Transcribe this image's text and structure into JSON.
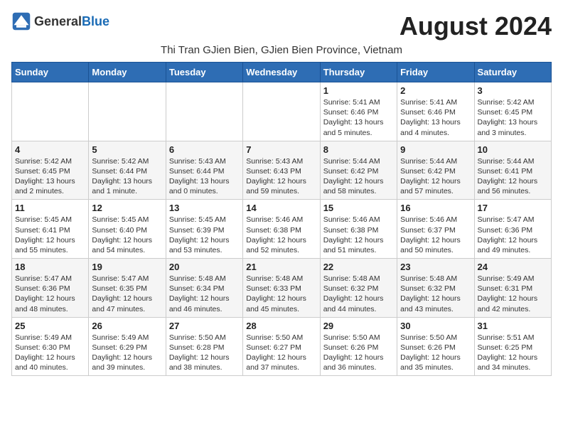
{
  "header": {
    "logo_general": "General",
    "logo_blue": "Blue",
    "title": "August 2024",
    "subtitle": "Thi Tran GJien Bien, GJien Bien Province, Vietnam"
  },
  "days_of_week": [
    "Sunday",
    "Monday",
    "Tuesday",
    "Wednesday",
    "Thursday",
    "Friday",
    "Saturday"
  ],
  "weeks": [
    [
      {
        "day": "",
        "info": ""
      },
      {
        "day": "",
        "info": ""
      },
      {
        "day": "",
        "info": ""
      },
      {
        "day": "",
        "info": ""
      },
      {
        "day": "1",
        "info": "Sunrise: 5:41 AM\nSunset: 6:46 PM\nDaylight: 13 hours\nand 5 minutes."
      },
      {
        "day": "2",
        "info": "Sunrise: 5:41 AM\nSunset: 6:46 PM\nDaylight: 13 hours\nand 4 minutes."
      },
      {
        "day": "3",
        "info": "Sunrise: 5:42 AM\nSunset: 6:45 PM\nDaylight: 13 hours\nand 3 minutes."
      }
    ],
    [
      {
        "day": "4",
        "info": "Sunrise: 5:42 AM\nSunset: 6:45 PM\nDaylight: 13 hours\nand 2 minutes."
      },
      {
        "day": "5",
        "info": "Sunrise: 5:42 AM\nSunset: 6:44 PM\nDaylight: 13 hours\nand 1 minute."
      },
      {
        "day": "6",
        "info": "Sunrise: 5:43 AM\nSunset: 6:44 PM\nDaylight: 13 hours\nand 0 minutes."
      },
      {
        "day": "7",
        "info": "Sunrise: 5:43 AM\nSunset: 6:43 PM\nDaylight: 12 hours\nand 59 minutes."
      },
      {
        "day": "8",
        "info": "Sunrise: 5:44 AM\nSunset: 6:42 PM\nDaylight: 12 hours\nand 58 minutes."
      },
      {
        "day": "9",
        "info": "Sunrise: 5:44 AM\nSunset: 6:42 PM\nDaylight: 12 hours\nand 57 minutes."
      },
      {
        "day": "10",
        "info": "Sunrise: 5:44 AM\nSunset: 6:41 PM\nDaylight: 12 hours\nand 56 minutes."
      }
    ],
    [
      {
        "day": "11",
        "info": "Sunrise: 5:45 AM\nSunset: 6:41 PM\nDaylight: 12 hours\nand 55 minutes."
      },
      {
        "day": "12",
        "info": "Sunrise: 5:45 AM\nSunset: 6:40 PM\nDaylight: 12 hours\nand 54 minutes."
      },
      {
        "day": "13",
        "info": "Sunrise: 5:45 AM\nSunset: 6:39 PM\nDaylight: 12 hours\nand 53 minutes."
      },
      {
        "day": "14",
        "info": "Sunrise: 5:46 AM\nSunset: 6:38 PM\nDaylight: 12 hours\nand 52 minutes."
      },
      {
        "day": "15",
        "info": "Sunrise: 5:46 AM\nSunset: 6:38 PM\nDaylight: 12 hours\nand 51 minutes."
      },
      {
        "day": "16",
        "info": "Sunrise: 5:46 AM\nSunset: 6:37 PM\nDaylight: 12 hours\nand 50 minutes."
      },
      {
        "day": "17",
        "info": "Sunrise: 5:47 AM\nSunset: 6:36 PM\nDaylight: 12 hours\nand 49 minutes."
      }
    ],
    [
      {
        "day": "18",
        "info": "Sunrise: 5:47 AM\nSunset: 6:36 PM\nDaylight: 12 hours\nand 48 minutes."
      },
      {
        "day": "19",
        "info": "Sunrise: 5:47 AM\nSunset: 6:35 PM\nDaylight: 12 hours\nand 47 minutes."
      },
      {
        "day": "20",
        "info": "Sunrise: 5:48 AM\nSunset: 6:34 PM\nDaylight: 12 hours\nand 46 minutes."
      },
      {
        "day": "21",
        "info": "Sunrise: 5:48 AM\nSunset: 6:33 PM\nDaylight: 12 hours\nand 45 minutes."
      },
      {
        "day": "22",
        "info": "Sunrise: 5:48 AM\nSunset: 6:32 PM\nDaylight: 12 hours\nand 44 minutes."
      },
      {
        "day": "23",
        "info": "Sunrise: 5:48 AM\nSunset: 6:32 PM\nDaylight: 12 hours\nand 43 minutes."
      },
      {
        "day": "24",
        "info": "Sunrise: 5:49 AM\nSunset: 6:31 PM\nDaylight: 12 hours\nand 42 minutes."
      }
    ],
    [
      {
        "day": "25",
        "info": "Sunrise: 5:49 AM\nSunset: 6:30 PM\nDaylight: 12 hours\nand 40 minutes."
      },
      {
        "day": "26",
        "info": "Sunrise: 5:49 AM\nSunset: 6:29 PM\nDaylight: 12 hours\nand 39 minutes."
      },
      {
        "day": "27",
        "info": "Sunrise: 5:50 AM\nSunset: 6:28 PM\nDaylight: 12 hours\nand 38 minutes."
      },
      {
        "day": "28",
        "info": "Sunrise: 5:50 AM\nSunset: 6:27 PM\nDaylight: 12 hours\nand 37 minutes."
      },
      {
        "day": "29",
        "info": "Sunrise: 5:50 AM\nSunset: 6:26 PM\nDaylight: 12 hours\nand 36 minutes."
      },
      {
        "day": "30",
        "info": "Sunrise: 5:50 AM\nSunset: 6:26 PM\nDaylight: 12 hours\nand 35 minutes."
      },
      {
        "day": "31",
        "info": "Sunrise: 5:51 AM\nSunset: 6:25 PM\nDaylight: 12 hours\nand 34 minutes."
      }
    ]
  ]
}
